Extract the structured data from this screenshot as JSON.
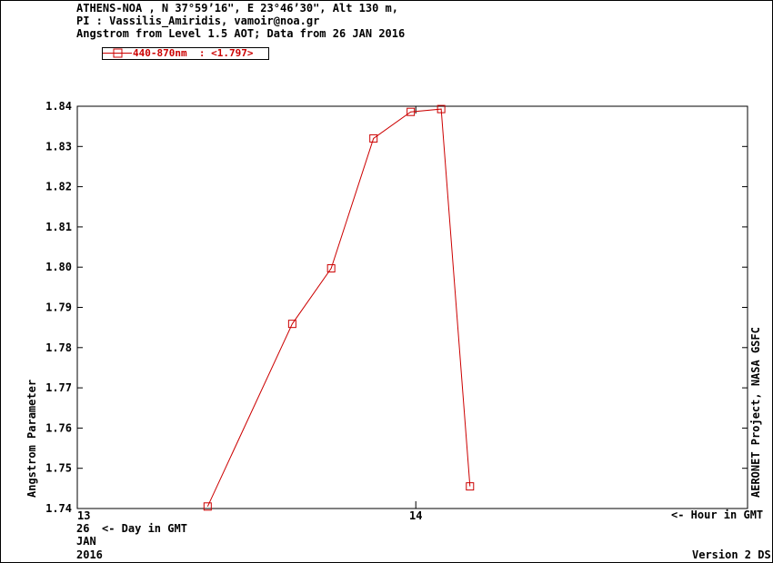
{
  "header": {
    "line1": "ATHENS-NOA , N 37°59’16\", E 23°46’30\", Alt 130 m,",
    "line2": "PI : Vassilis_Amiridis, vamoir@noa.gr",
    "line3": "Angstrom from Level 1.5 AOT; Data from 26 JAN 2016"
  },
  "legend": {
    "label": "440-870nm  : <1.797>",
    "color": "#cc0000"
  },
  "axis": {
    "ylabel": "Angstrom Parameter",
    "xhint_hour": "<- Hour in GMT",
    "xhint_day": "<- Day in GMT",
    "day": "26",
    "month": "JAN",
    "year": "2016"
  },
  "side_credit": "AERONET Project, NASA GSFC",
  "version": "Version 2 DS",
  "chart_data": {
    "type": "line",
    "x_unit": "hour GMT",
    "xlim": [
      13.0,
      14.98
    ],
    "ylim": [
      1.74,
      1.84
    ],
    "xticks": [
      13,
      14
    ],
    "xtick_labels": [
      "13",
      "14"
    ],
    "yticks": [
      1.74,
      1.75,
      1.76,
      1.77,
      1.78,
      1.79,
      1.8,
      1.81,
      1.82,
      1.83,
      1.84
    ],
    "ytick_labels": [
      "1.74",
      "1.75",
      "1.76",
      "1.77",
      "1.78",
      "1.79",
      "1.80",
      "1.81",
      "1.82",
      "1.83",
      "1.84"
    ],
    "series": [
      {
        "name": "440-870nm",
        "color": "#cc0000",
        "marker": "square",
        "x": [
          13.385,
          13.635,
          13.75,
          13.875,
          13.985,
          14.075,
          14.16
        ],
        "y": [
          1.7405,
          1.7859,
          1.7997,
          1.832,
          1.8386,
          1.8393,
          1.7455
        ]
      }
    ]
  }
}
